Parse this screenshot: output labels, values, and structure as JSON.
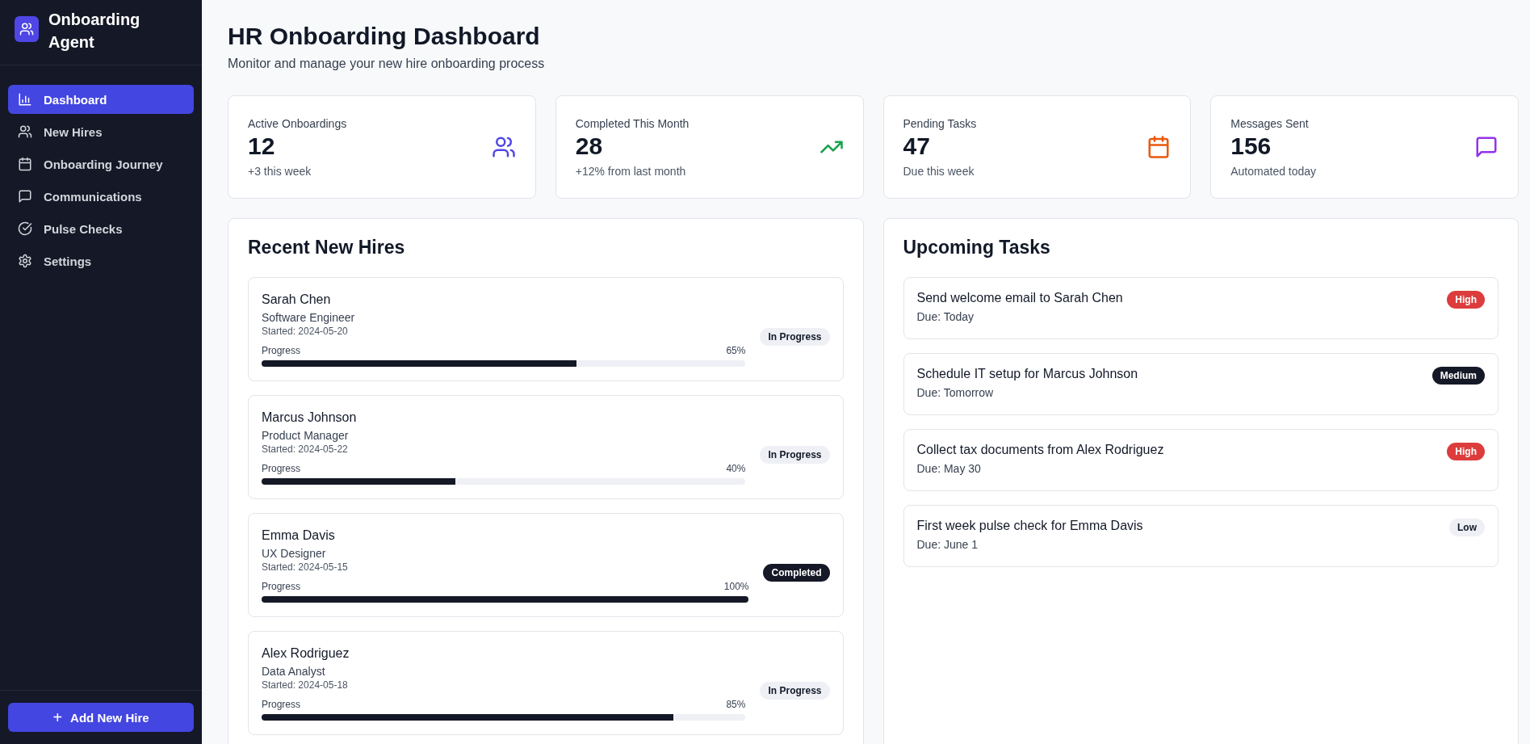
{
  "app": {
    "name": "Onboarding Agent"
  },
  "sidebar": {
    "items": [
      {
        "label": "Dashboard",
        "kind": "chart",
        "selected": true
      },
      {
        "label": "New Hires",
        "kind": "users",
        "selected": false
      },
      {
        "label": "Onboarding Journey",
        "kind": "calendar",
        "selected": false
      },
      {
        "label": "Communications",
        "kind": "message",
        "selected": false
      },
      {
        "label": "Pulse Checks",
        "kind": "check",
        "selected": false
      },
      {
        "label": "Settings",
        "kind": "gear",
        "selected": false
      }
    ],
    "button": {
      "icon": "+",
      "label": "Add New Hire"
    }
  },
  "header": {
    "title": "HR Onboarding Dashboard",
    "subtitle": "Monitor and manage your new hire onboarding process"
  },
  "stats": [
    {
      "label": "Active Onboardings",
      "value": "12",
      "note": "+3 this week",
      "kind": "users",
      "color": "#4f46e5"
    },
    {
      "label": "Completed This Month",
      "value": "28",
      "note": "+12% from last month",
      "kind": "trend",
      "color": "#16a34a"
    },
    {
      "label": "Pending Tasks",
      "value": "47",
      "note": "Due this week",
      "kind": "calendar",
      "color": "#ea580c"
    },
    {
      "label": "Messages Sent",
      "value": "156",
      "note": "Automated today",
      "kind": "message",
      "color": "#9333ea"
    }
  ],
  "recent_hires": {
    "title": "Recent New Hires",
    "items": [
      {
        "name": "Sarah Chen",
        "role": "Software Engineer",
        "started": "Started: 2024-05-20",
        "progress_label": "Progress",
        "percent": "65%",
        "level": 0.65,
        "status": "In Progress",
        "kind": "in_progress"
      },
      {
        "name": "Marcus Johnson",
        "role": "Product Manager",
        "started": "Started: 2024-05-22",
        "progress_label": "Progress",
        "percent": "40%",
        "level": 0.4,
        "status": "In Progress",
        "kind": "in_progress"
      },
      {
        "name": "Emma Davis",
        "role": "UX Designer",
        "started": "Started: 2024-05-15",
        "progress_label": "Progress",
        "percent": "100%",
        "level": 1,
        "status": "Completed",
        "kind": "completed"
      },
      {
        "name": "Alex Rodriguez",
        "role": "Data Analyst",
        "started": "Started: 2024-05-18",
        "progress_label": "Progress",
        "percent": "85%",
        "level": 0.85,
        "status": "In Progress",
        "kind": "in_progress"
      }
    ]
  },
  "upcoming_tasks": {
    "title": "Upcoming Tasks",
    "items": [
      {
        "title": "Send welcome email to Sarah Chen",
        "due": "Due: Today",
        "priority": "High",
        "kind": "high"
      },
      {
        "title": "Schedule IT setup for Marcus Johnson",
        "due": "Due: Tomorrow",
        "priority": "Medium",
        "kind": "medium"
      },
      {
        "title": "Collect tax documents from Alex Rodriguez",
        "due": "Due: May 30",
        "priority": "High",
        "kind": "high"
      },
      {
        "title": "First week pulse check for Emma Davis",
        "due": "Due: June 1",
        "priority": "Low",
        "kind": "low"
      }
    ]
  }
}
